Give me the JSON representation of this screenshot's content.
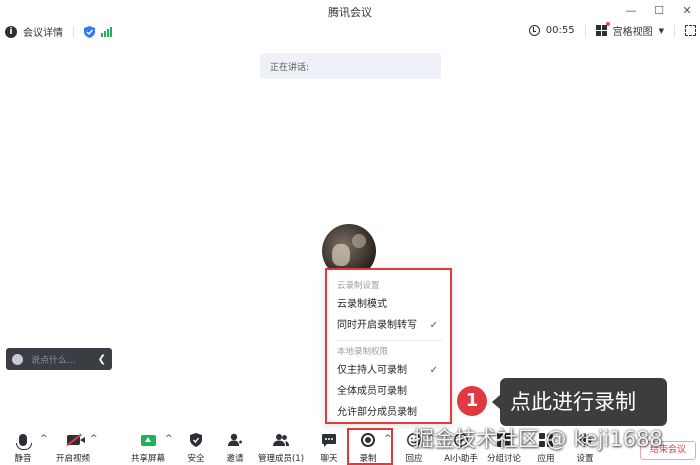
{
  "window": {
    "title": "腾讯会议"
  },
  "infobar": {
    "meeting_details": "会议详情",
    "timer": "00:55",
    "view_mode": "宫格视图"
  },
  "speaking": {
    "label": "正在讲话:"
  },
  "chat": {
    "placeholder": "说点什么..."
  },
  "record_menu": {
    "cloud_section": "云录制设置",
    "cloud_mode": "云录制模式",
    "cloud_transcribe": "同时开启录制转写",
    "local_section": "本地录制权限",
    "host_only": "仅主持人可录制",
    "all_members": "全体成员可录制",
    "some_members": "允许部分成员录制"
  },
  "callout": {
    "number": "1",
    "text": "点此进行录制"
  },
  "watermark": "掘金技术社区 @ keji1688",
  "toolbar": {
    "mute": "静音",
    "video": "开启视频",
    "share": "共享屏幕",
    "security": "安全",
    "invite": "邀请",
    "members": "管理成员(1)",
    "chat": "聊天",
    "record": "录制",
    "reaction": "回应",
    "ai": "AI小助手",
    "breakout": "分组讨论",
    "apps": "应用",
    "settings": "设置",
    "end": "结束会议"
  },
  "colors": {
    "accent_red": "#e2383f",
    "share_green": "#22b05a",
    "signal_green": "#22b05a",
    "shield_blue": "#2f7cf6"
  }
}
